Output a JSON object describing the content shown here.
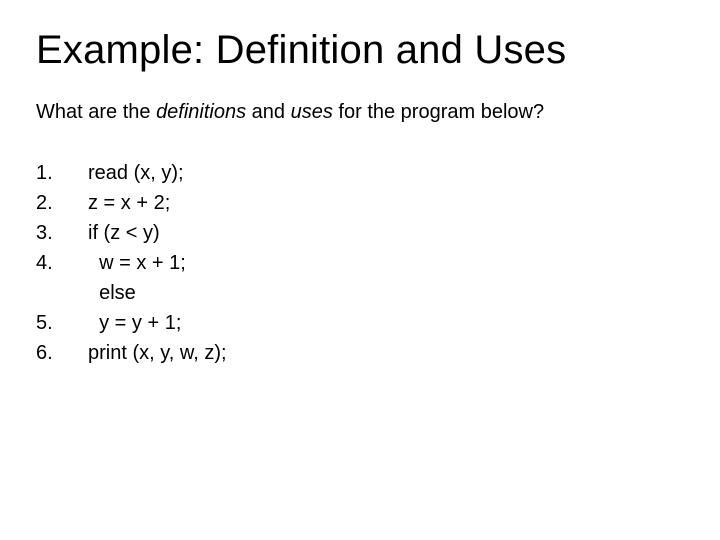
{
  "title": "Example: Definition and Uses",
  "question": {
    "p1": "What are the ",
    "i1": "definitions",
    "p2": " and ",
    "i2": "uses",
    "p3": " for the program below?"
  },
  "lines": {
    "n1": "1.",
    "c1": "read (x, y);",
    "n2": "2.",
    "c2": "z = x + 2;",
    "n3": "3.",
    "c3": "if (z < y)",
    "n4": "4.",
    "c4": "  w = x + 1;",
    "nE": "",
    "cE": "  else",
    "n5": "5.",
    "c5": "  y = y + 1;",
    "n6": "6.",
    "c6": "print (x, y, w, z);"
  }
}
